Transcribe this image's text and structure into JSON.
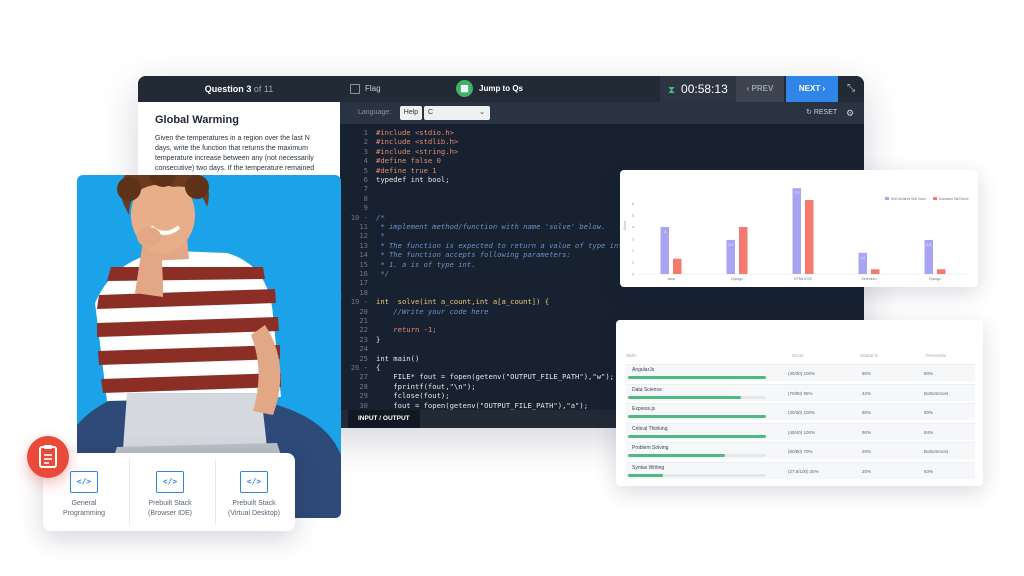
{
  "ide": {
    "question_prefix": "Question",
    "question_num": "3",
    "question_of": "of 11",
    "flag_label": "Flag",
    "jump_label": "Jump to Qs",
    "timer": "00:58:13",
    "prev_label": "PREV",
    "next_label": "NEXT",
    "language_label": "Language:",
    "help_label": "Help",
    "language_value": "C",
    "reset_label": "RESET",
    "io_tab": "INPUT / OUTPUT"
  },
  "question": {
    "title": "Global Warming",
    "text": "Given the temperatures in a region over the last N days, write the function that returns the maximum temperature increase between any (not necessarily consecutive) two days. If the temperature remained"
  },
  "code_lines": [
    {
      "n": "1",
      "t": "#include <stdio.h>",
      "c": "pre"
    },
    {
      "n": "2",
      "t": "#include <stdlib.h>",
      "c": "pre"
    },
    {
      "n": "3",
      "t": "#include <string.h>",
      "c": "pre"
    },
    {
      "n": "4",
      "t": "#define false 0",
      "c": "pre"
    },
    {
      "n": "5",
      "t": "#define true 1",
      "c": "pre"
    },
    {
      "n": "6",
      "t": "typedef int bool;",
      "c": "tx"
    },
    {
      "n": "7",
      "t": "",
      "c": "tx"
    },
    {
      "n": "8",
      "t": "",
      "c": "tx"
    },
    {
      "n": "9",
      "t": "",
      "c": "tx"
    },
    {
      "n": "10 -",
      "t": "/*",
      "c": "cm"
    },
    {
      "n": "11",
      "t": " * implement method/function with name 'solve' below.",
      "c": "cm"
    },
    {
      "n": "12",
      "t": " *",
      "c": "cm"
    },
    {
      "n": "13",
      "t": " * The function is expected to return a value of type int",
      "c": "cm"
    },
    {
      "n": "14",
      "t": " * The function accepts following parameters:",
      "c": "cm"
    },
    {
      "n": "15",
      "t": " * 1. a is of type int.",
      "c": "cm"
    },
    {
      "n": "16",
      "t": " */",
      "c": "cm"
    },
    {
      "n": "17",
      "t": "",
      "c": "tx"
    },
    {
      "n": "18",
      "t": "",
      "c": "tx"
    },
    {
      "n": "19 -",
      "t": "int  solve(int a_count,int a[a_count]) {",
      "c": "kw"
    },
    {
      "n": "20",
      "t": "    //Write your code here",
      "c": "cm"
    },
    {
      "n": "21",
      "t": "",
      "c": "tx"
    },
    {
      "n": "22",
      "t": "    return -1;",
      "c": "pre"
    },
    {
      "n": "23",
      "t": "}",
      "c": "tx"
    },
    {
      "n": "24",
      "t": "",
      "c": "tx"
    },
    {
      "n": "25",
      "t": "int main()",
      "c": "tx"
    },
    {
      "n": "26 -",
      "t": "{",
      "c": "tx"
    },
    {
      "n": "27",
      "t": "    FILE* fout = fopen(getenv(\"OUTPUT_FILE_PATH\"),\"w\");",
      "c": "tx"
    },
    {
      "n": "28",
      "t": "    fprintf(fout,\"\\n\");",
      "c": "tx"
    },
    {
      "n": "29",
      "t": "    fclose(fout);",
      "c": "tx"
    },
    {
      "n": "30",
      "t": "    fout = fopen(getenv(\"OUTPUT_FILE_PATH\"),\"a\");",
      "c": "tx"
    }
  ],
  "tech_options": [
    {
      "label1": "General",
      "label2": "Programming",
      "icon": "</>"
    },
    {
      "label1": "Prebuilt Stack",
      "label2": "(Browser IDE)",
      "icon": "</>"
    },
    {
      "label1": "Prebuilt Stack",
      "label2": "(Virtual Desktop)",
      "icon": "</>"
    }
  ],
  "chart_data": {
    "type": "bar",
    "categories": [
      "Java",
      "Django",
      "HTML/CSS",
      "Selenium",
      "Django"
    ],
    "series": [
      {
        "name": "Self Declared Skill Score",
        "values": [
          4,
          2.9,
          7.3,
          1.8,
          2.9
        ],
        "color": "#a8a4f3"
      },
      {
        "name": "Assessed Skill Score",
        "values": [
          1.3,
          4,
          6.3,
          0.4,
          0.4
        ],
        "color": "#f4796e"
      }
    ],
    "ylim": [
      0,
      8
    ],
    "yticks": [
      "0",
      "1",
      "2",
      "3",
      "4",
      "5",
      "6"
    ],
    "ylabel": "Score",
    "legend": "top-right",
    "value_labels": [
      "4",
      "2.9",
      "7.3",
      "1.8",
      "2.9"
    ]
  },
  "skills": {
    "headers": [
      "Skills",
      "Score",
      "Global %",
      "Percentile"
    ],
    "rows": [
      {
        "name": "AngularJs",
        "score": "(30/30) 100%",
        "global": "80%",
        "pct": "80%",
        "progress": 1.0
      },
      {
        "name": "Data Science",
        "score": "(70/90) 95%",
        "global": "42%",
        "pct": "Bottommost",
        "progress": 0.82
      },
      {
        "name": "Express.js",
        "score": "(30/30) 100%",
        "global": "80%",
        "pct": "80%",
        "progress": 1.0
      },
      {
        "name": "Critical Thinking",
        "score": "(40/40) 100%",
        "global": "90%",
        "pct": "84%",
        "progress": 1.0
      },
      {
        "name": "Problem Solving",
        "score": "(80/80) 70%",
        "global": "20%",
        "pct": "Bottommost",
        "progress": 0.7
      },
      {
        "name": "Syntax Writing",
        "score": "(27.5/100) 25%",
        "global": "20%",
        "pct": "63%",
        "progress": 0.25
      }
    ]
  },
  "colors": {
    "accent": "#2f86e8",
    "photo_bg": "#1aa3e8",
    "badge": "#ea4a3a",
    "progress": "#50b982"
  }
}
